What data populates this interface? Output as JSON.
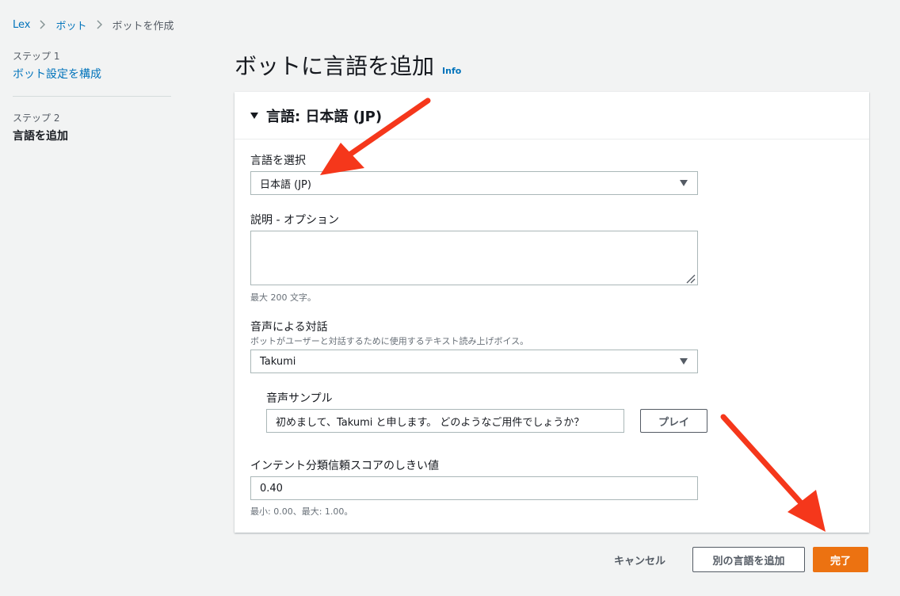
{
  "breadcrumb": {
    "items": [
      {
        "label": "Lex"
      },
      {
        "label": "ボット"
      },
      {
        "label": "ボットを作成"
      }
    ]
  },
  "steps": [
    {
      "step_label": "ステップ 1",
      "title": "ボット設定を構成"
    },
    {
      "step_label": "ステップ 2",
      "title": "言語を追加"
    }
  ],
  "page": {
    "title": "ボットに言語を追加",
    "info_label": "Info"
  },
  "panel": {
    "title": "言語: 日本語 (JP)",
    "language": {
      "label": "言語を選択",
      "value": "日本語 (JP)"
    },
    "description": {
      "label": "説明 - オプション",
      "value": "",
      "hint": "最大 200 文字。"
    },
    "voice": {
      "label": "音声による対話",
      "desc": "ボットがユーザーと対話するために使用するテキスト読み上げボイス。",
      "value": "Takumi"
    },
    "sample": {
      "label": "音声サンプル",
      "value": "初めまして、Takumi と申します。 どのようなご用件でしょうか？",
      "play_label": "プレイ"
    },
    "threshold": {
      "label": "インテント分類信頼スコアのしきい値",
      "value": "0.40",
      "hint": "最小: 0.00、最大: 1.00。"
    }
  },
  "footer": {
    "cancel_label": "キャンセル",
    "add_language_label": "別の言語を追加",
    "done_label": "完了"
  },
  "colors": {
    "link": "#0073bb",
    "primary": "#ec7211",
    "annotation_arrow": "#f5371b",
    "background": "#f2f3f3"
  }
}
